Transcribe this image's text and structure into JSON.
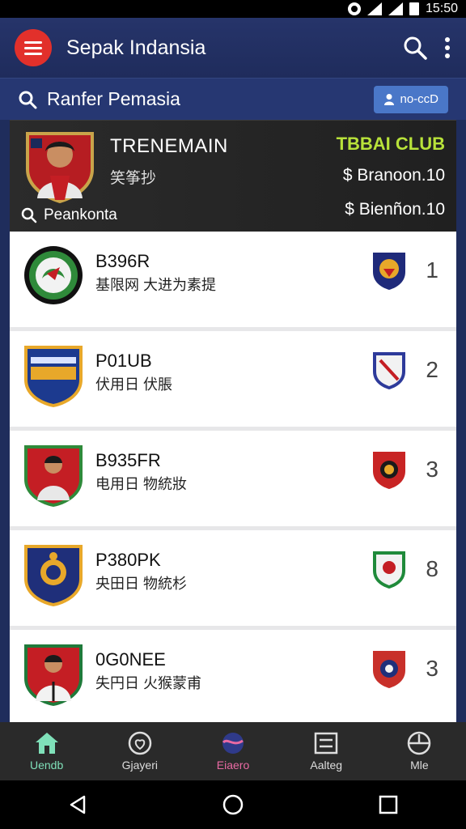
{
  "status_bar": {
    "time": "15:50"
  },
  "app_bar": {
    "title": "Sepak Indansia"
  },
  "search_row": {
    "label": "Ranfer Pemasia",
    "chip_label": "no-ccD"
  },
  "featured": {
    "name": "TRENEMAIN",
    "subtitle": "笑筝抄",
    "club": "TBBAI CLUB",
    "price_top": "$ Branoon.10",
    "price_bottom": "$ Bienñon.10",
    "search_label": "Peankonta"
  },
  "list": [
    {
      "code": "B396R",
      "desc": "基限网 大进为素提",
      "rank": "1",
      "crest_color": "#1c4a1c",
      "mini_color": "#3a2a8a"
    },
    {
      "code": "P01UB",
      "desc": "伏用日 伏脹",
      "rank": "2",
      "crest_color": "#1c3a8f",
      "mini_color": "#2d3a9a"
    },
    {
      "code": "B935FR",
      "desc": "电用日 物統妝",
      "rank": "3",
      "crest_color": "#2f8a3a",
      "mini_color": "#c82424"
    },
    {
      "code": "P380PK",
      "desc": "央田日 物統杉",
      "rank": "8",
      "crest_color": "#1f2f7a",
      "mini_color": "#1f8a3a"
    },
    {
      "code": "0G0NEE",
      "desc": "失円日 火猴蒙甫",
      "rank": "3",
      "crest_color": "#1f7a3a",
      "mini_color": "#c8302a"
    }
  ],
  "bottom_nav": [
    {
      "label": "Uendb",
      "icon": "home-icon"
    },
    {
      "label": "Gjayeri",
      "icon": "heart-icon"
    },
    {
      "label": "Eiaero",
      "icon": "wave-icon"
    },
    {
      "label": "Aalteg",
      "icon": "list-icon"
    },
    {
      "label": "Mle",
      "icon": "compass-icon"
    }
  ],
  "colors": {
    "app_bar": "#26346a",
    "menu_button": "#e2302b",
    "club_accent": "#b8e23a",
    "chip": "#4a77c8"
  }
}
